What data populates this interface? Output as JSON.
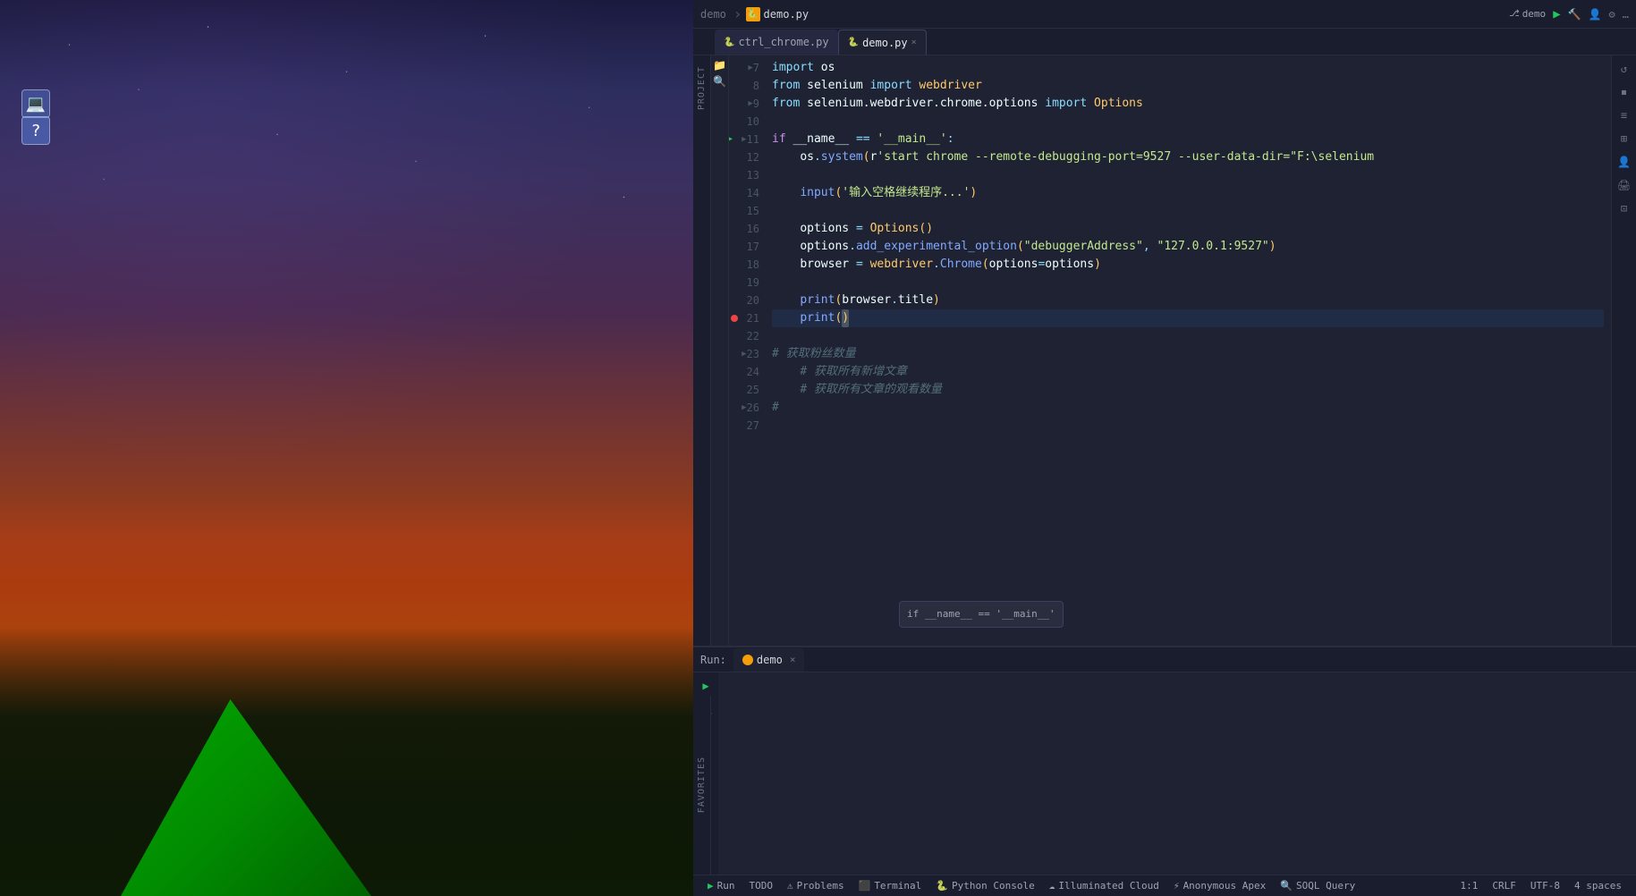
{
  "desktop": {
    "visible": true
  },
  "ide": {
    "titlebar": {
      "project": "demo",
      "file": "demo.py",
      "branch": "demo"
    },
    "tabs": [
      {
        "id": "ctrl_chrome",
        "label": "ctrl_chrome.py",
        "active": false,
        "icon": "🐍"
      },
      {
        "id": "demo",
        "label": "demo.py",
        "active": true,
        "icon": "🐍"
      }
    ],
    "code": {
      "lines": [
        {
          "num": 7,
          "indent": 2,
          "content": "import os",
          "type": "import",
          "fold": true
        },
        {
          "num": 8,
          "indent": 2,
          "content": "from selenium import webdriver",
          "type": "import"
        },
        {
          "num": 9,
          "indent": 2,
          "content": "from selenium.webdriver.chrome.options import Options",
          "type": "import",
          "fold": true
        },
        {
          "num": 10,
          "indent": 0,
          "content": "",
          "type": "empty"
        },
        {
          "num": 11,
          "indent": 0,
          "content": "if __name__ == '__main__':",
          "type": "code",
          "fold": true,
          "run": true
        },
        {
          "num": 12,
          "indent": 4,
          "content": "    os.system(r'start chrome --remote-debugging-port=9527 --user-data-dir=\"F:\\selenium",
          "type": "code"
        },
        {
          "num": 13,
          "indent": 0,
          "content": "",
          "type": "empty"
        },
        {
          "num": 14,
          "indent": 4,
          "content": "    input('输入空格继续程序...')",
          "type": "code"
        },
        {
          "num": 15,
          "indent": 0,
          "content": "",
          "type": "empty"
        },
        {
          "num": 16,
          "indent": 4,
          "content": "    options = Options()",
          "type": "code"
        },
        {
          "num": 17,
          "indent": 4,
          "content": "    options.add_experimental_option(\"debuggerAddress\", \"127.0.0.1:9527\")",
          "type": "code"
        },
        {
          "num": 18,
          "indent": 4,
          "content": "    browser = webdriver.Chrome(options=options)",
          "type": "code"
        },
        {
          "num": 19,
          "indent": 0,
          "content": "",
          "type": "empty"
        },
        {
          "num": 20,
          "indent": 4,
          "content": "    print(browser.title)",
          "type": "code"
        },
        {
          "num": 21,
          "indent": 4,
          "content": "    print()",
          "type": "code",
          "active": true,
          "breakpoint": true
        },
        {
          "num": 22,
          "indent": 0,
          "content": "",
          "type": "empty"
        },
        {
          "num": 23,
          "indent": 0,
          "content": "# 获取粉丝数量",
          "type": "comment",
          "fold": true
        },
        {
          "num": 24,
          "indent": 0,
          "content": "    # 获取所有新增文章",
          "type": "comment"
        },
        {
          "num": 25,
          "indent": 0,
          "content": "    # 获取所有文章的观看数量",
          "type": "comment"
        },
        {
          "num": 26,
          "indent": 0,
          "content": "#",
          "type": "comment",
          "fold": true
        },
        {
          "num": 27,
          "indent": 0,
          "content": "",
          "type": "empty"
        }
      ]
    },
    "hint_popup": "if __name__ == '__main__'",
    "run_panel": {
      "label": "Run:",
      "tab": "demo",
      "content": ""
    },
    "statusbar": {
      "items": [
        {
          "id": "run",
          "label": "▶ Run",
          "icon": "▶"
        },
        {
          "id": "todo",
          "label": "TODO"
        },
        {
          "id": "problems",
          "label": "⚠ Problems"
        },
        {
          "id": "terminal",
          "label": "Terminal"
        },
        {
          "id": "python-console",
          "label": "Python Console"
        },
        {
          "id": "illuminated-cloud",
          "label": "Illuminated Cloud"
        },
        {
          "id": "anonymous-apex",
          "label": "Anonymous Apex"
        },
        {
          "id": "soql-query",
          "label": "SOQL Query"
        }
      ],
      "right_items": [
        {
          "id": "line-col",
          "label": "1:1"
        },
        {
          "id": "crlf",
          "label": "CRLF"
        },
        {
          "id": "encoding",
          "label": "UTF-8"
        },
        {
          "id": "indent",
          "label": "4 spaces"
        }
      ]
    }
  }
}
